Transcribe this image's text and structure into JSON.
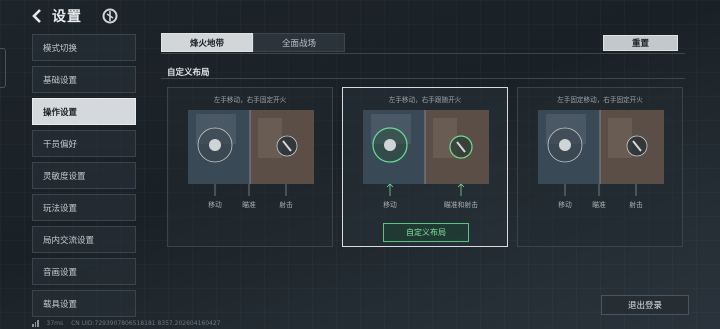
{
  "header": {
    "title": "设置",
    "back_icon": "back-arrow-icon",
    "logo_icon": "game-logo-icon"
  },
  "sidebar": {
    "items": [
      {
        "label": "模式切换",
        "active": false
      },
      {
        "label": "基础设置",
        "active": false
      },
      {
        "label": "操作设置",
        "active": true
      },
      {
        "label": "干员偏好",
        "active": false
      },
      {
        "label": "灵敏度设置",
        "active": false
      },
      {
        "label": "玩法设置",
        "active": false
      },
      {
        "label": "局内交流设置",
        "active": false
      },
      {
        "label": "音画设置",
        "active": false
      },
      {
        "label": "载具设置",
        "active": false
      }
    ]
  },
  "tabs": [
    {
      "label": "烽火地带",
      "active": true
    },
    {
      "label": "全面战场",
      "active": false
    }
  ],
  "reset_label": "重置",
  "section_title": "自定义布局",
  "layouts": [
    {
      "desc": "左手移动，右手固定开火",
      "labels": [
        "移动",
        "瞄准",
        "射击"
      ]
    },
    {
      "desc": "左手移动，右手跟随开火",
      "labels": [
        "移动",
        "瞄准和射击"
      ]
    },
    {
      "desc": "左手固定移动，右手固定开火",
      "labels": [
        "移动",
        "瞄准",
        "射击"
      ]
    }
  ],
  "custom_layout_label": "自定义布局",
  "logout_label": "退出登录",
  "status": {
    "ping": "37ms",
    "uid": "CN UID:7293907806518181 8357.202604160427"
  },
  "colors": {
    "accent_green": "#58c57e",
    "active_item": "#d6d9db"
  }
}
